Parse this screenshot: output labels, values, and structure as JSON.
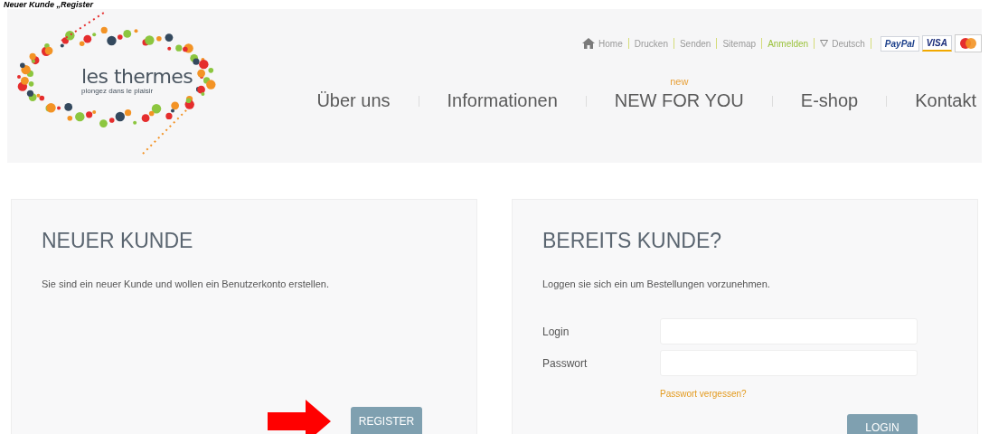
{
  "caption": "Neuer Kunde „Register",
  "logo": {
    "name": "les thermes",
    "tagline": "plongez dans le plaisir"
  },
  "top_links": [
    {
      "label": "Home",
      "kind": "home",
      "selected": false
    },
    {
      "label": "Drucken",
      "kind": "plain",
      "selected": false
    },
    {
      "label": "Senden",
      "kind": "plain",
      "selected": false
    },
    {
      "label": "Sitemap",
      "kind": "plain",
      "selected": false
    },
    {
      "label": "Anmelden",
      "kind": "plain",
      "selected": true
    },
    {
      "label": "Deutsch",
      "kind": "language",
      "selected": false
    }
  ],
  "payment_badges": [
    {
      "label": "PayPal",
      "kind": "paypal"
    },
    {
      "label": "VISA",
      "kind": "visa"
    },
    {
      "kind": "mastercard"
    }
  ],
  "main_nav": [
    {
      "label": "Über uns"
    },
    {
      "label": "Informationen"
    },
    {
      "label": "NEW FOR YOU",
      "badge": "new"
    },
    {
      "label": "E-shop"
    },
    {
      "label": "Kontakt"
    }
  ],
  "new_customer": {
    "title": "NEUER KUNDE",
    "text": "Sie sind ein neuer Kunde und wollen ein Benutzerkonto erstellen.",
    "button": "REGISTER"
  },
  "existing_customer": {
    "title": "BEREITS KUNDE?",
    "text": "Loggen sie sich ein um Bestellungen vorzunehmen.",
    "fields": [
      {
        "label": "Login"
      },
      {
        "label": "Passwort"
      }
    ],
    "forgot_link": "Passwort vergessen?",
    "button": "LOGIN"
  }
}
